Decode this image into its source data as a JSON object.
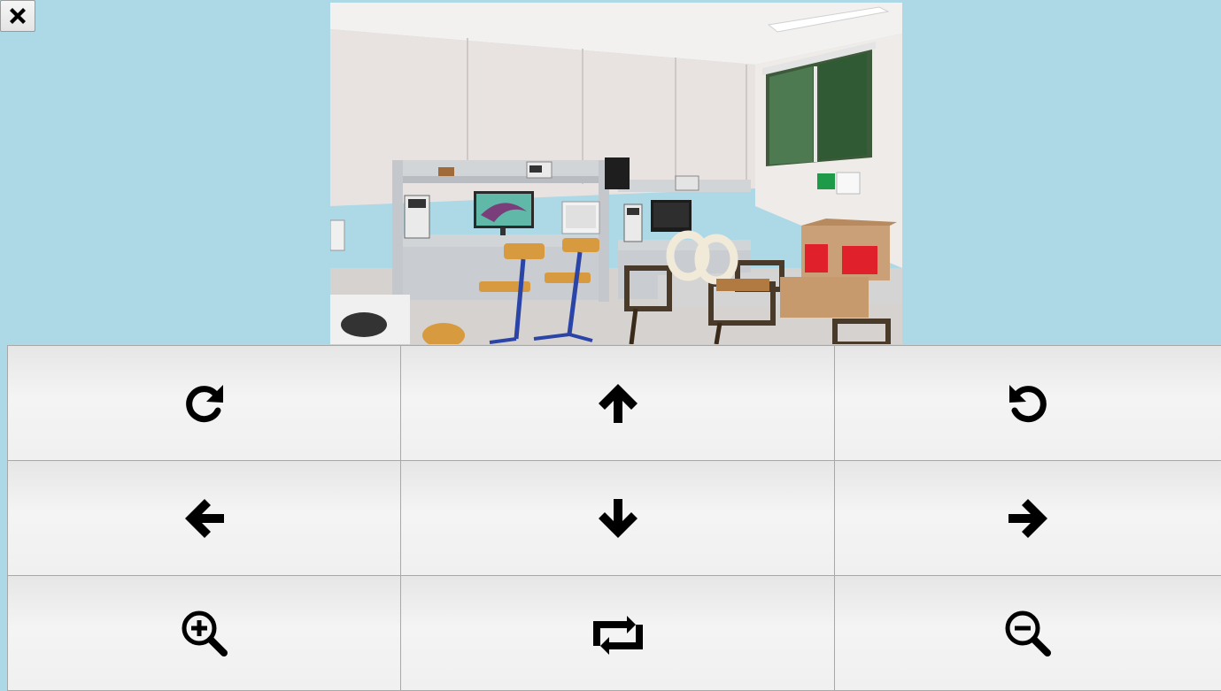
{
  "close": {
    "icon": "close-icon"
  },
  "photo": {
    "subject": "classroom-lab-photo",
    "colors": {
      "wall": "#e9e4e2",
      "ceiling": "#f4f2f0",
      "floor": "#d8d4d2",
      "bench": "#d7d9dc",
      "chair_wood": "#d99a3e",
      "chair_metal": "#2a44a8",
      "box": "#c99c72",
      "label_red": "#e0202a"
    }
  },
  "controls": [
    {
      "name": "rotate-clockwise-button",
      "icon": "rotate-clockwise-icon"
    },
    {
      "name": "move-up-button",
      "icon": "arrow-up-icon"
    },
    {
      "name": "rotate-counterclockwise-button",
      "icon": "rotate-counterclockwise-icon"
    },
    {
      "name": "move-left-button",
      "icon": "arrow-left-icon"
    },
    {
      "name": "move-down-button",
      "icon": "arrow-down-icon"
    },
    {
      "name": "move-right-button",
      "icon": "arrow-right-icon"
    },
    {
      "name": "zoom-in-button",
      "icon": "zoom-in-icon"
    },
    {
      "name": "reset-button",
      "icon": "retweet-icon"
    },
    {
      "name": "zoom-out-button",
      "icon": "zoom-out-icon"
    }
  ],
  "theme": {
    "background": "#add8e6",
    "button_border": "#a8a8a8",
    "icon_color": "#000000"
  }
}
